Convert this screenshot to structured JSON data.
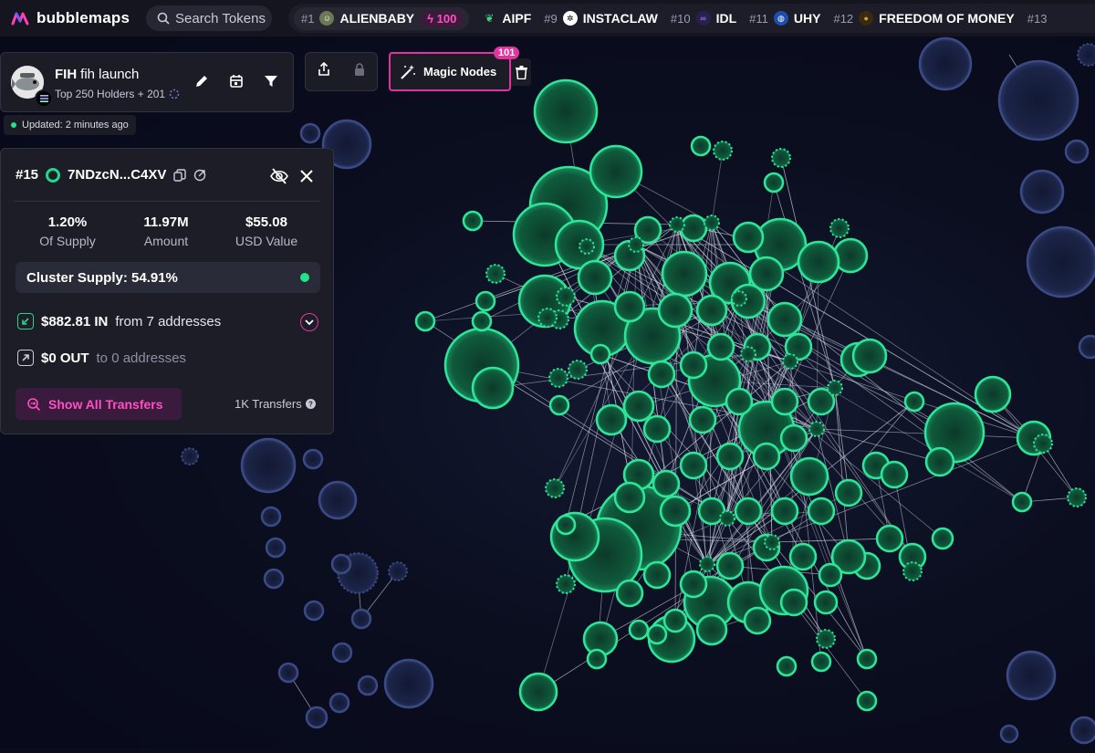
{
  "brand": {
    "name": "bubblemaps"
  },
  "search": {
    "placeholder": "Search Tokens",
    "icon": "search-icon"
  },
  "trending": [
    {
      "rank": "#1",
      "name": "ALIENBABY",
      "boost": "100",
      "icon": "alien-avatar-icon"
    },
    {
      "rank": "",
      "name": "AIPF",
      "icon": "leaf-icon"
    },
    {
      "rank": "#9",
      "name": "INSTACLAW",
      "icon": "crab-icon"
    },
    {
      "rank": "#10",
      "name": "IDL",
      "icon": "infinity-icon"
    },
    {
      "rank": "#11",
      "name": "UHY",
      "icon": "globe-icon"
    },
    {
      "rank": "#12",
      "name": "FREEDOM OF MONEY",
      "icon": "coin-icon"
    },
    {
      "rank": "#13",
      "name": "",
      "icon": ""
    }
  ],
  "token": {
    "symbol": "FIH",
    "name": "fih launch",
    "subtitle": "Top 250 Holders + 201",
    "updated": "Updated: 2 minutes ago"
  },
  "magic_nodes": {
    "label": "Magic Nodes",
    "count": "101"
  },
  "wallet": {
    "rank": "#15",
    "address": "7NDzcN...C4XV",
    "stats": [
      {
        "value": "1.20%",
        "label": "Of Supply"
      },
      {
        "value": "11.97M",
        "label": "Amount"
      },
      {
        "value": "$55.08",
        "label": "USD Value"
      }
    ],
    "cluster_supply": "Cluster Supply: 54.91%",
    "in_amount": "$882.81 IN",
    "in_from": "from 7 addresses",
    "out_amount": "$0 OUT",
    "out_to": "to 0 addresses",
    "show_transfers": "Show All Transfers",
    "transfer_count": "1K Transfers"
  },
  "colors": {
    "accent": "#e0359f",
    "cluster_green": "#22d68a",
    "bubble_blue": "#2a3561",
    "background": "#0a0c1a"
  }
}
